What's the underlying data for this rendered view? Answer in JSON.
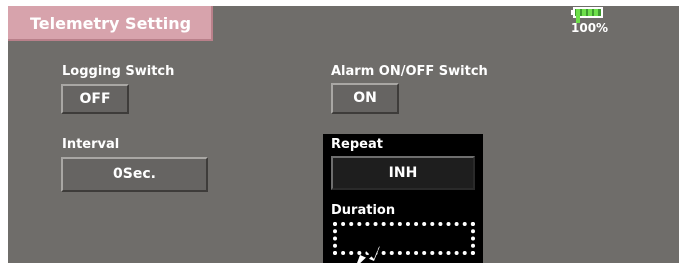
{
  "header": {
    "title": "Telemetry Setting"
  },
  "battery": {
    "percent_text": "100%",
    "level": 1.0
  },
  "logging": {
    "label": "Logging Switch",
    "value": "OFF"
  },
  "alarm": {
    "label": "Alarm ON/OFF Switch",
    "value": "ON"
  },
  "interval": {
    "label": "Interval",
    "value": "0Sec."
  },
  "repeat": {
    "label": "Repeat",
    "value": "INH"
  },
  "duration": {
    "label": "Duration",
    "value": ""
  },
  "colors": {
    "screen_bg": "#6f6d6a",
    "title_tab": "#d7a3ac",
    "battery_fill": "#6ee04b"
  }
}
